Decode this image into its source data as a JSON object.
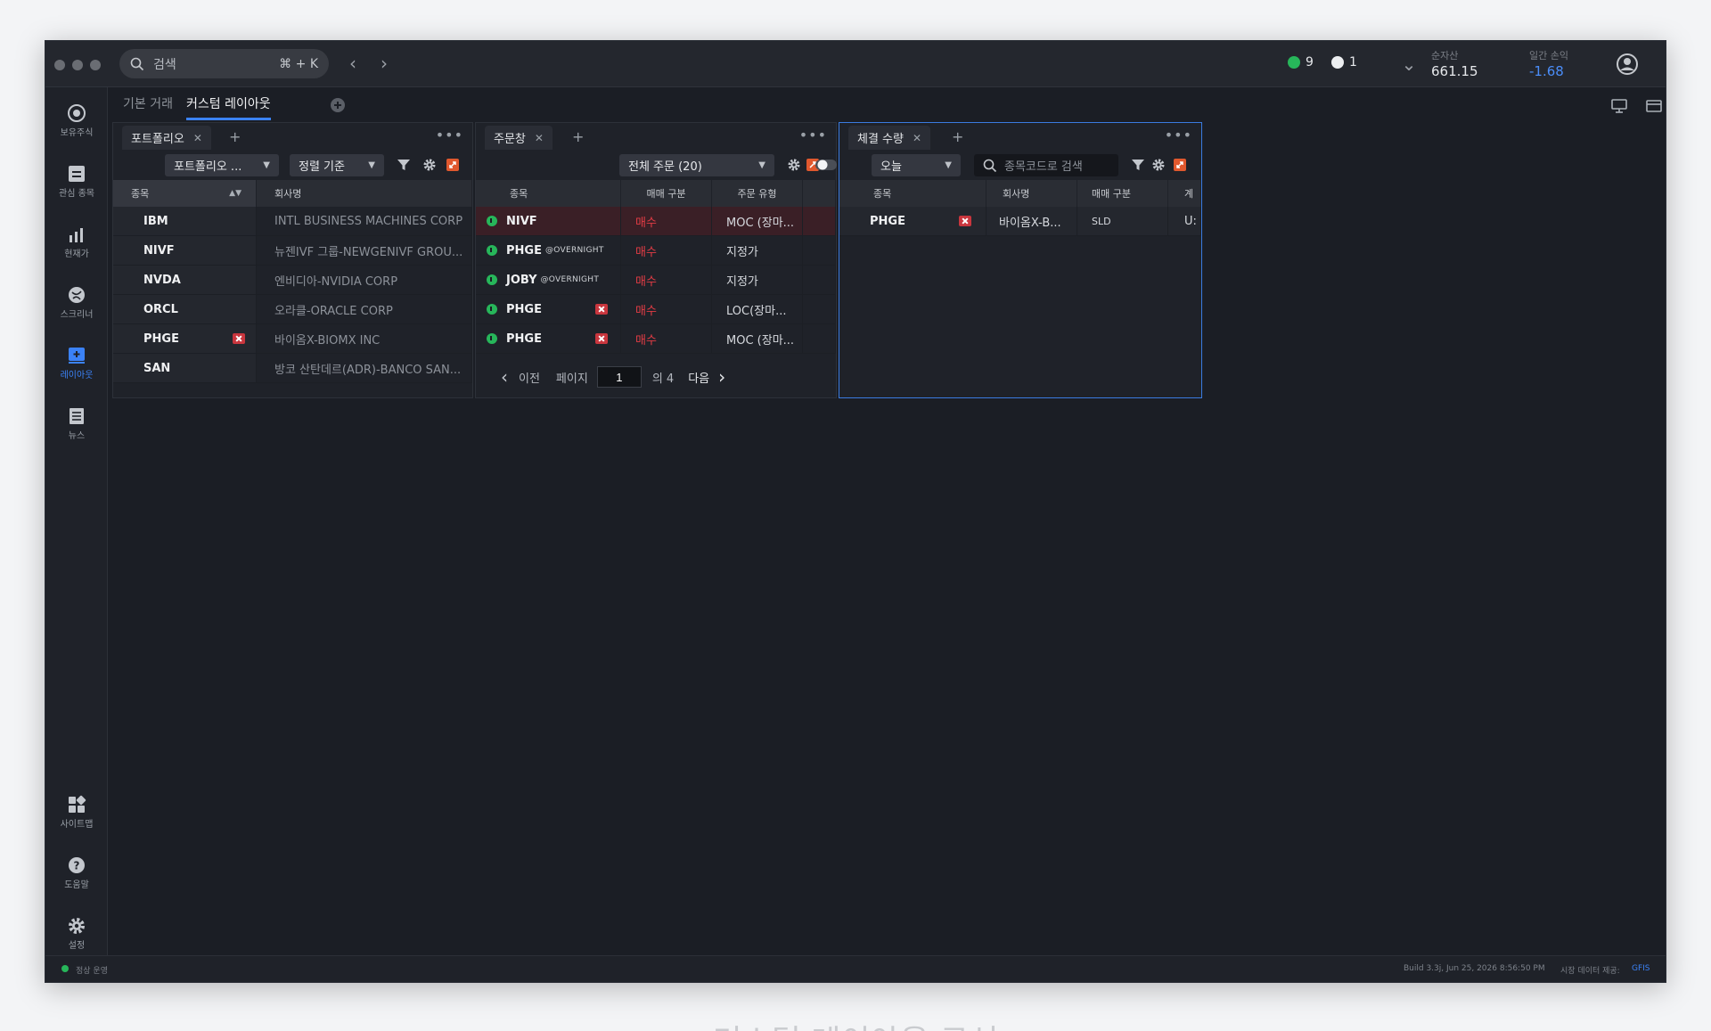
{
  "titlebar": {
    "search_placeholder": "검색",
    "search_shortcut": "⌘ + K",
    "status_green_count": "9",
    "status_white_count": "1",
    "net_asset_label": "순자산",
    "net_asset_value": "661.15",
    "daily_pnl_label": "일간 손익",
    "daily_pnl_value": "-1.68"
  },
  "layout_tabs": {
    "basic": "기본 거래",
    "custom": "커스텀 레이아웃"
  },
  "rail": [
    {
      "icon": "holdings-icon",
      "label": "보유주식"
    },
    {
      "icon": "watchlist-icon",
      "label": "관심 종목"
    },
    {
      "icon": "price-chart-icon",
      "label": "현재가"
    },
    {
      "icon": "screener-icon",
      "label": "스크리너"
    },
    {
      "icon": "layout-icon",
      "label": "레이아웃"
    },
    {
      "icon": "news-icon",
      "label": "뉴스"
    },
    {
      "icon": "sitemap-icon",
      "label": "사이트맵"
    },
    {
      "icon": "help-icon",
      "label": "도움말"
    },
    {
      "icon": "settings-icon",
      "label": "설정"
    }
  ],
  "portfolio": {
    "tab": "포트폴리오",
    "dropdown": "포트폴리오 ...",
    "sort": "정렬 기준",
    "headers": [
      "종목",
      "회사명"
    ],
    "rows": [
      {
        "symbol": "IBM",
        "company": "INTL BUSINESS MACHINES CORP"
      },
      {
        "symbol": "NIVF",
        "company": "뉴젠IVF 그룹-NEWGENIVF GROU..."
      },
      {
        "symbol": "NVDA",
        "company": "엔비디아-NVIDIA CORP"
      },
      {
        "symbol": "ORCL",
        "company": "오라클-ORACLE CORP"
      },
      {
        "symbol": "PHGE",
        "company": "바이옴X-BIOMX INC"
      },
      {
        "symbol": "SAN",
        "company": "방코 산탄데르(ADR)-BANCO SAN..."
      }
    ]
  },
  "orders": {
    "tab": "주문창",
    "filter": "전체 주문 (20)",
    "headers": [
      "종목",
      "매매 구분",
      "주문 유형"
    ],
    "rows": [
      {
        "symbol": "NIVF",
        "tag": "",
        "side": "매수",
        "type": "MOC (장마..."
      },
      {
        "symbol": "PHGE",
        "tag": "@OVERNIGHT",
        "side": "매수",
        "type": "지정가"
      },
      {
        "symbol": "JOBY",
        "tag": "@OVERNIGHT",
        "side": "매수",
        "type": "지정가"
      },
      {
        "symbol": "PHGE",
        "tag": "",
        "side": "매수",
        "type": "LOC(장마..."
      },
      {
        "symbol": "PHGE",
        "tag": "",
        "side": "매수",
        "type": "MOC (장마..."
      }
    ],
    "pager": {
      "prev": "이전",
      "page_label": "페이지",
      "page": "1",
      "of": "의 4",
      "next": "다음"
    }
  },
  "fills": {
    "tab": "체결 수량",
    "period": "오늘",
    "search_placeholder": "종목코드로 검색",
    "headers": [
      "종목",
      "회사명",
      "매매 구분",
      "계"
    ],
    "rows": [
      {
        "symbol": "PHGE",
        "company": "바이옴X-B...",
        "side": "SLD",
        "acct": "U:"
      }
    ]
  },
  "statusbar": {
    "state": "정상 운영",
    "build": "Build 3.3j, Jun 25, 2026 8:56:50 PM",
    "data_label": "시장 데이터 제공:",
    "data_provider": "GFIS"
  },
  "caption": "커스텀 레이아웃 구성",
  "colors": {
    "accent": "#3b82f6",
    "buy": "#e33c45",
    "ok": "#27b65a",
    "negative": "#4b8df8"
  }
}
